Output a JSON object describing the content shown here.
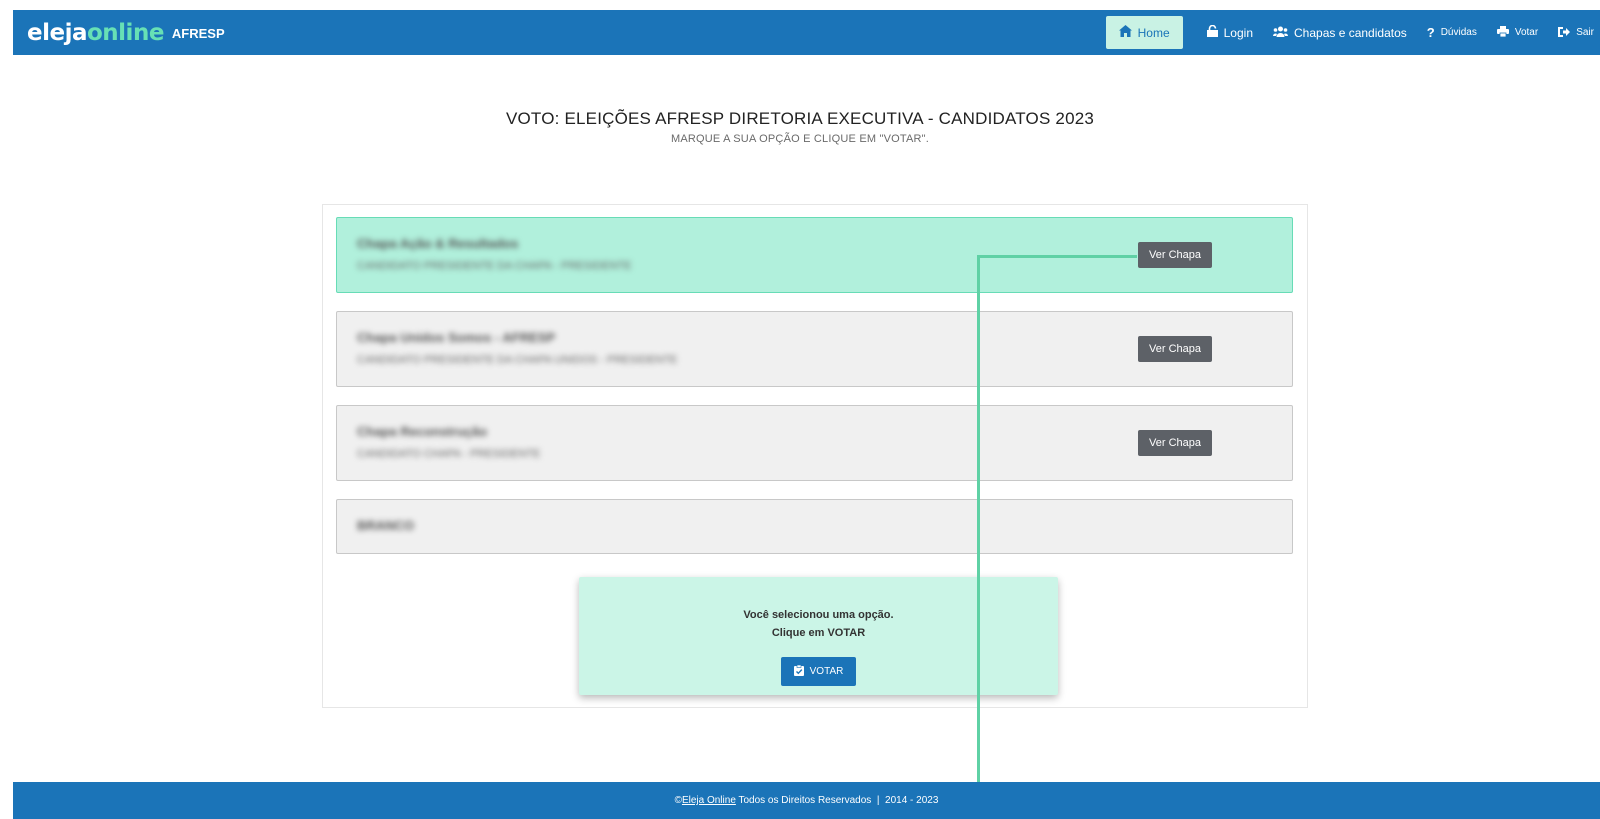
{
  "brand": {
    "name_part1": "eleja",
    "name_part2": "online",
    "org": "AFRESP"
  },
  "nav": {
    "home": {
      "icon": "home-icon",
      "label": "Home"
    },
    "login": {
      "icon": "lock-icon",
      "label": "Login"
    },
    "chapas": {
      "icon": "users-icon",
      "label": "Chapas e candidatos"
    },
    "duvidas": {
      "icon": "question-icon",
      "label": "Dúvidas"
    },
    "votar": {
      "icon": "printer-icon",
      "label": "Votar"
    },
    "sair": {
      "icon": "sign-out-icon",
      "label": "Sair"
    }
  },
  "heading": {
    "title": "VOTO: ELEIÇÕES AFRESP DIRETORIA EXECUTIVA - CANDIDATOS 2023",
    "subtitle": "MARQUE A SUA OPÇÃO E CLIQUE EM \"VOTAR\"."
  },
  "options": [
    {
      "title": "Chapa Ação & Resultados",
      "subtitle": "CANDIDATO PRESIDENTE DA CHAPA - PRESIDENTE",
      "button": "Ver Chapa",
      "selected": true
    },
    {
      "title": "Chapa Unidos Somos - AFRESP",
      "subtitle": "CANDIDATO PRESIDENTE DA CHAPA UNIDOS - PRESIDENTE",
      "button": "Ver Chapa",
      "selected": false
    },
    {
      "title": "Chapa Reconstrução",
      "subtitle": "CANDIDATO CHAPA - PRESIDENTE",
      "button": "Ver Chapa",
      "selected": false
    },
    {
      "title": "BRANCO",
      "subtitle": "",
      "button": "",
      "selected": false
    }
  ],
  "confirm": {
    "line1": "Você selecionou uma opção.",
    "line2": "Clique em VOTAR",
    "button_icon": "clipboard-check-icon",
    "button_label": "VOTAR"
  },
  "footer": {
    "copyright": "©",
    "link": "Eleja Online",
    "text": " Todos os Direitos Reservados  |  2014 - 2023"
  },
  "colors": {
    "primary": "#1b74b8",
    "accent": "#67e0b5",
    "selected_bg": "#b1f0dc",
    "confirm_bg": "#cbf5e7",
    "button_gray": "#5d6167"
  }
}
